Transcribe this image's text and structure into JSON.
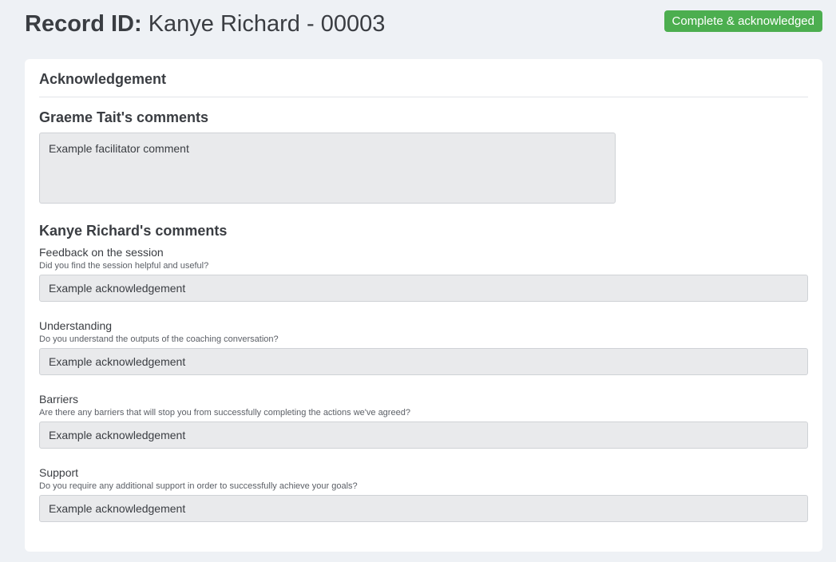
{
  "header": {
    "record_label": "Record ID:",
    "record_value": "Kanye Richard - 00003",
    "status_badge": "Complete & acknowledged"
  },
  "colors": {
    "status_badge": "#4cae4f",
    "page_background": "#eef1f5"
  },
  "card": {
    "title": "Acknowledgement",
    "facilitator": {
      "heading": "Graeme Tait's comments",
      "comment": "Example facilitator comment"
    },
    "learner": {
      "heading": "Kanye Richard's comments",
      "questions": [
        {
          "label": "Feedback on the session",
          "hint": "Did you find the session helpful and useful?",
          "answer": "Example acknowledgement"
        },
        {
          "label": "Understanding",
          "hint": "Do you understand the outputs of the coaching conversation?",
          "answer": "Example acknowledgement"
        },
        {
          "label": "Barriers",
          "hint": "Are there any barriers that will stop you from successfully completing the actions we've agreed?",
          "answer": "Example acknowledgement"
        },
        {
          "label": "Support",
          "hint": "Do you require any additional support in order to successfully achieve your goals?",
          "answer": "Example acknowledgement"
        }
      ]
    }
  }
}
